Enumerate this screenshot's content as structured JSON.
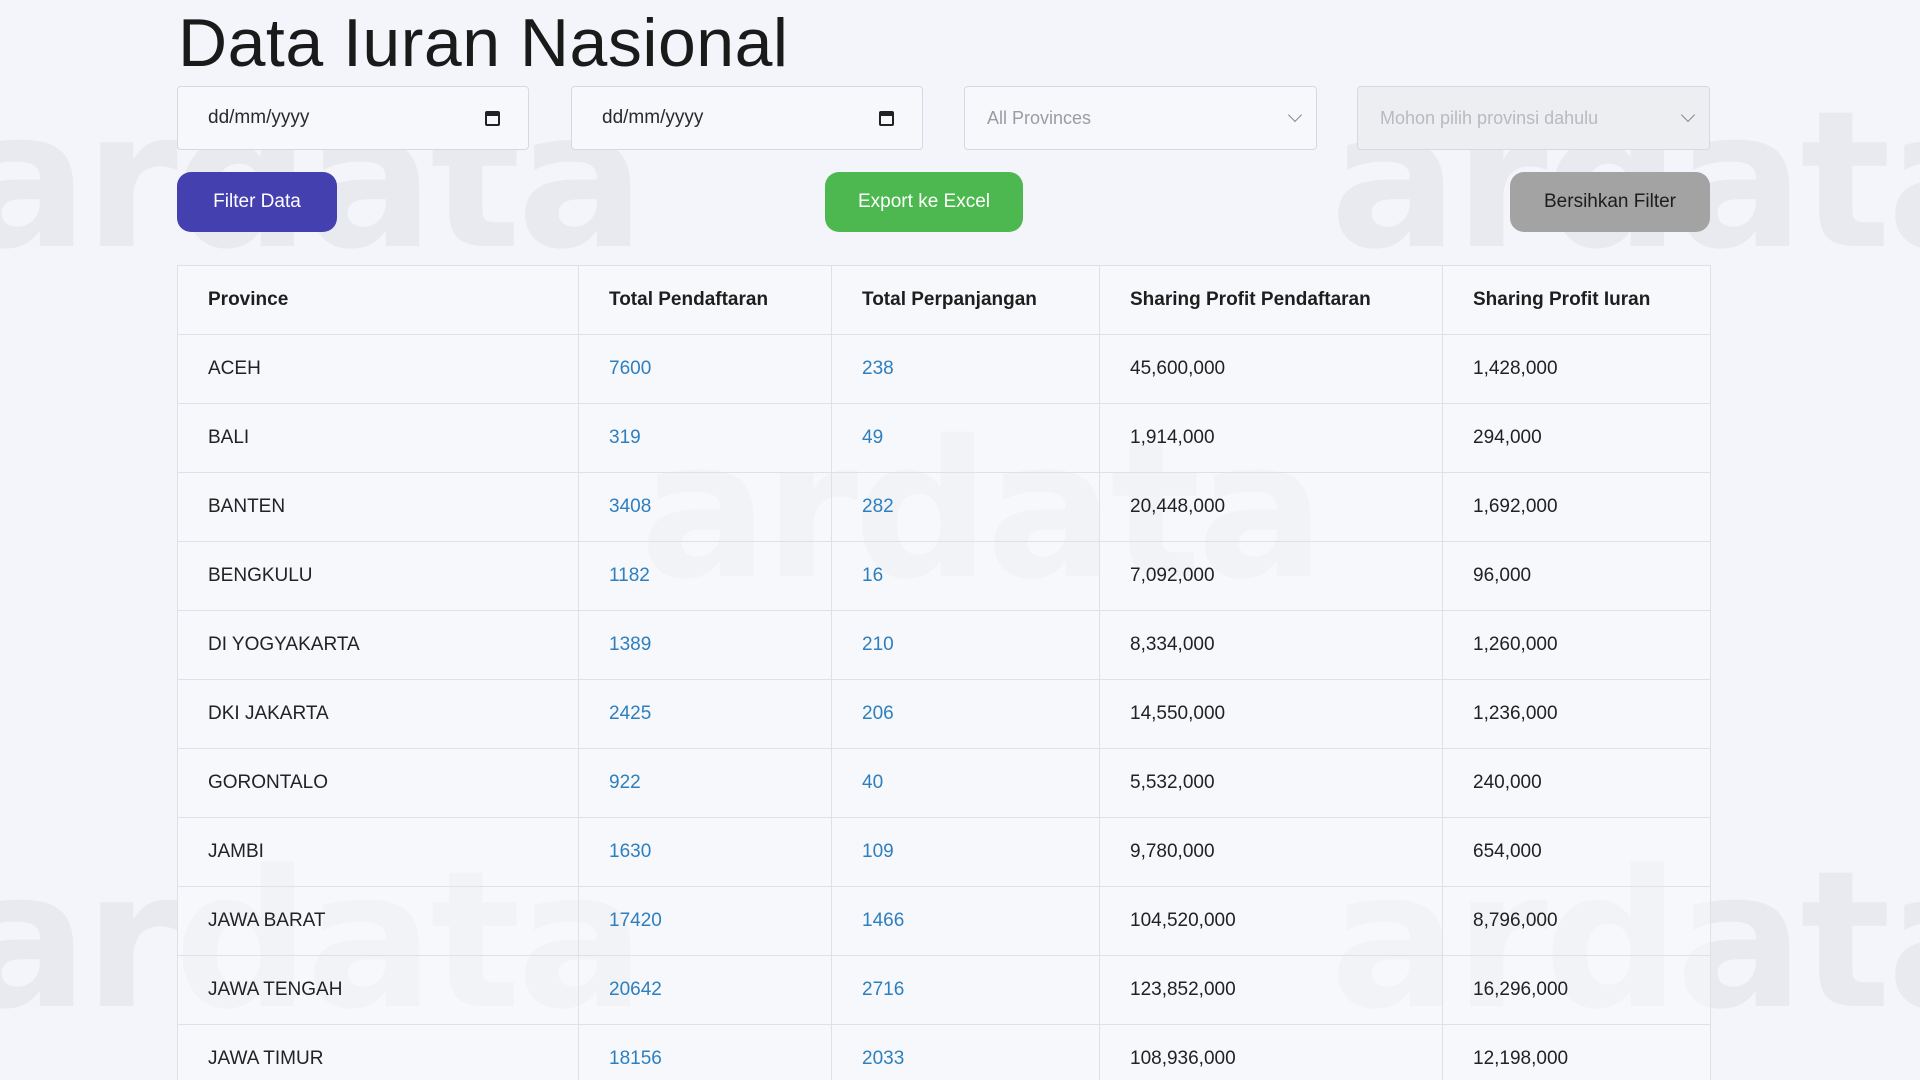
{
  "page": {
    "title": "Data Iuran Nasional"
  },
  "filters": {
    "start_date_placeholder": "dd/mm/yyyy",
    "end_date_placeholder": "dd/mm/yyyy",
    "province_select_value": "All Provinces",
    "city_select_value": "Mohon pilih provinsi dahulu"
  },
  "buttons": {
    "filter_label": "Filter Data",
    "export_label": "Export ke Excel",
    "clear_label": "Bersihkan Filter"
  },
  "colors": {
    "filter_button": "#4540b0",
    "export_button": "#4cb84f",
    "clear_button": "#a3a3a3",
    "link_text": "#2e7fbf"
  },
  "table": {
    "headers": [
      "Province",
      "Total Pendaftaran",
      "Total Perpanjangan",
      "Sharing Profit Pendaftaran",
      "Sharing Profit Iuran"
    ],
    "rows": [
      [
        "ACEH",
        "7600",
        "238",
        "45,600,000",
        "1,428,000"
      ],
      [
        "BALI",
        "319",
        "49",
        "1,914,000",
        "294,000"
      ],
      [
        "BANTEN",
        "3408",
        "282",
        "20,448,000",
        "1,692,000"
      ],
      [
        "BENGKULU",
        "1182",
        "16",
        "7,092,000",
        "96,000"
      ],
      [
        "DI YOGYAKARTA",
        "1389",
        "210",
        "8,334,000",
        "1,260,000"
      ],
      [
        "DKI JAKARTA",
        "2425",
        "206",
        "14,550,000",
        "1,236,000"
      ],
      [
        "GORONTALO",
        "922",
        "40",
        "5,532,000",
        "240,000"
      ],
      [
        "JAMBI",
        "1630",
        "109",
        "9,780,000",
        "654,000"
      ],
      [
        "JAWA BARAT",
        "17420",
        "1466",
        "104,520,000",
        "8,796,000"
      ],
      [
        "JAWA TENGAH",
        "20642",
        "2716",
        "123,852,000",
        "16,296,000"
      ],
      [
        "JAWA TIMUR",
        "18156",
        "2033",
        "108,936,000",
        "12,198,000"
      ]
    ]
  },
  "watermark": {
    "logo_text": "ardata"
  }
}
